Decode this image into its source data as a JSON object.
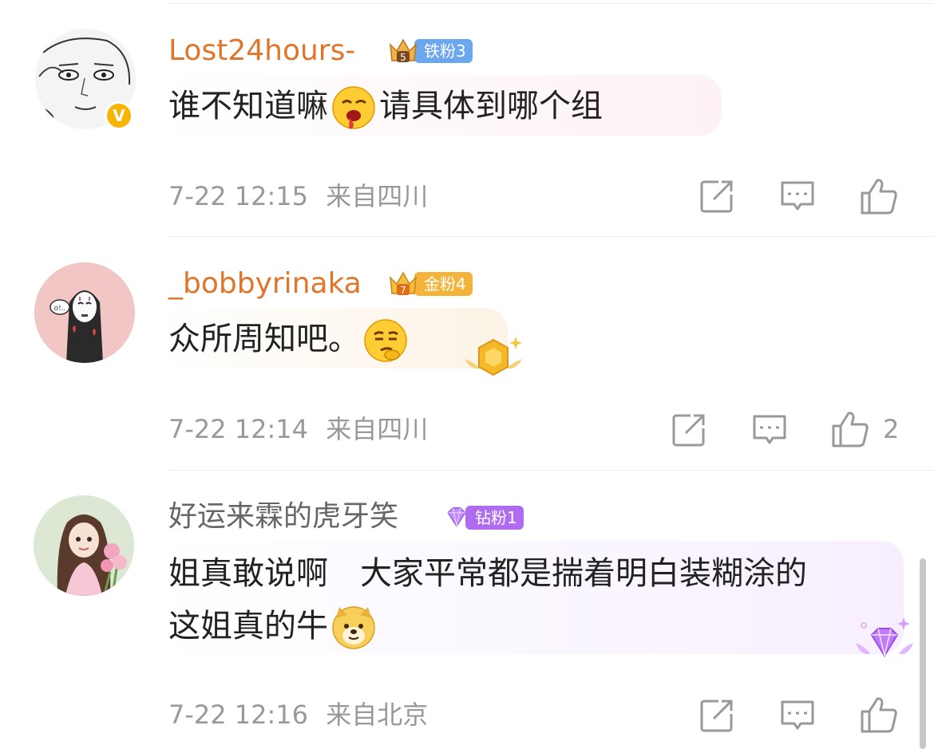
{
  "comments": [
    {
      "username": "Lost24hours-",
      "fan_badge": {
        "label": "铁粉3",
        "level": "5",
        "color": "#6aa7ef"
      },
      "verified": true,
      "text_before_emoji": "谁不知道嘛",
      "emoji": "drooling-face-icon",
      "text_after_emoji": "请具体到哪个组",
      "time": "7-22 12:15",
      "location": "来自四川",
      "likes": ""
    },
    {
      "username": "_bobbyrinaka",
      "fan_badge": {
        "label": "金粉4",
        "level": "7",
        "color": "#f4b43a"
      },
      "verified": false,
      "text": "众所周知吧。",
      "emoji": "thinking-face-icon",
      "time": "7-22 12:14",
      "location": "来自四川",
      "likes": "2"
    },
    {
      "username": "好运来霖的虎牙笑",
      "fan_badge": {
        "label": "钻粉1",
        "color": "#b06cf0"
      },
      "verified": false,
      "text_line1": "姐真敢说啊　大家平常都是揣着明白装糊涂的",
      "text_line2": "这姐真的牛",
      "emoji": "doge-icon",
      "time": "7-22 12:16",
      "location": "来自北京",
      "likes": ""
    }
  ]
}
